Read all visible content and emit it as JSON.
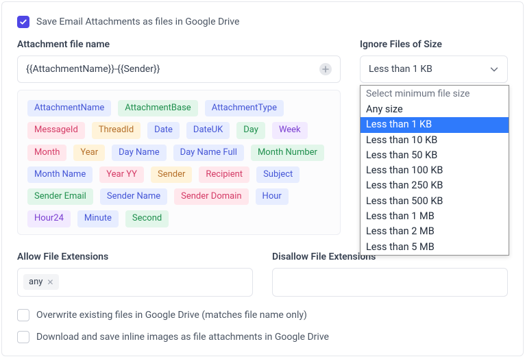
{
  "header": {
    "main_checkbox_label": "Save Email Attachments as files in Google Drive",
    "main_checkbox_checked": true
  },
  "attachment": {
    "title": "Attachment file name",
    "value": "{{AttachmentName}}-{{Sender}}"
  },
  "ignore": {
    "title": "Ignore Files of Size",
    "selected": "Less than 1 KB",
    "placeholder": "Select minimum file size",
    "options": [
      "Any size",
      "Less than 1 KB",
      "Less than 10 KB",
      "Less than 50 KB",
      "Less than 100 KB",
      "Less than 250 KB",
      "Less than 500 KB",
      "Less than 1 MB",
      "Less than 2 MB",
      "Less than 5 MB"
    ]
  },
  "tags": [
    {
      "label": "AttachmentName",
      "bg": "#e7edff",
      "fg": "#4455d6"
    },
    {
      "label": "AttachmentBase",
      "bg": "#e2f6ea",
      "fg": "#1f8f4d"
    },
    {
      "label": "AttachmentType",
      "bg": "#e7edff",
      "fg": "#4455d6"
    },
    {
      "label": "MessageId",
      "bg": "#ffe7ec",
      "fg": "#d43b66"
    },
    {
      "label": "ThreadId",
      "bg": "#fff3d9",
      "fg": "#b5702a"
    },
    {
      "label": "Date",
      "bg": "#e7edff",
      "fg": "#4455d6"
    },
    {
      "label": "DateUK",
      "bg": "#e7edff",
      "fg": "#4455d6"
    },
    {
      "label": "Day",
      "bg": "#e2f6ea",
      "fg": "#1f8f4d"
    },
    {
      "label": "Week",
      "bg": "#f2eaff",
      "fg": "#7b3fd1"
    },
    {
      "label": "Month",
      "bg": "#ffe7ec",
      "fg": "#d43b66"
    },
    {
      "label": "Year",
      "bg": "#fff3d9",
      "fg": "#b5702a"
    },
    {
      "label": "Day Name",
      "bg": "#e7edff",
      "fg": "#4455d6"
    },
    {
      "label": "Day Name Full",
      "bg": "#e7edff",
      "fg": "#4455d6"
    },
    {
      "label": "Month Number",
      "bg": "#e2f6ea",
      "fg": "#1f8f4d"
    },
    {
      "label": "Month Name",
      "bg": "#e7edff",
      "fg": "#4455d6"
    },
    {
      "label": "Year YY",
      "bg": "#ffe7ec",
      "fg": "#d43b66"
    },
    {
      "label": "Sender",
      "bg": "#fff3d9",
      "fg": "#b5702a"
    },
    {
      "label": "Recipient",
      "bg": "#ffe7ec",
      "fg": "#d43b66"
    },
    {
      "label": "Subject",
      "bg": "#e7edff",
      "fg": "#4455d6"
    },
    {
      "label": "Sender Email",
      "bg": "#e2f6ea",
      "fg": "#1f8f4d"
    },
    {
      "label": "Sender Name",
      "bg": "#e7edff",
      "fg": "#4455d6"
    },
    {
      "label": "Sender Domain",
      "bg": "#ffe7ec",
      "fg": "#d43b66"
    },
    {
      "label": "Hour",
      "bg": "#e7edff",
      "fg": "#4455d6"
    },
    {
      "label": "Hour24",
      "bg": "#f2eaff",
      "fg": "#7b3fd1"
    },
    {
      "label": "Minute",
      "bg": "#e7edff",
      "fg": "#4455d6"
    },
    {
      "label": "Second",
      "bg": "#e2f6ea",
      "fg": "#1f8f4d"
    }
  ],
  "allow": {
    "title": "Allow File Extensions",
    "tags": [
      "any"
    ]
  },
  "disallow": {
    "title": "Disallow File Extensions",
    "tags": []
  },
  "overwrite": {
    "label": "Overwrite existing files in Google Drive (matches file name only)",
    "checked": false
  },
  "inline": {
    "label": "Download and save inline images as file attachments in Google Drive",
    "checked": false
  }
}
